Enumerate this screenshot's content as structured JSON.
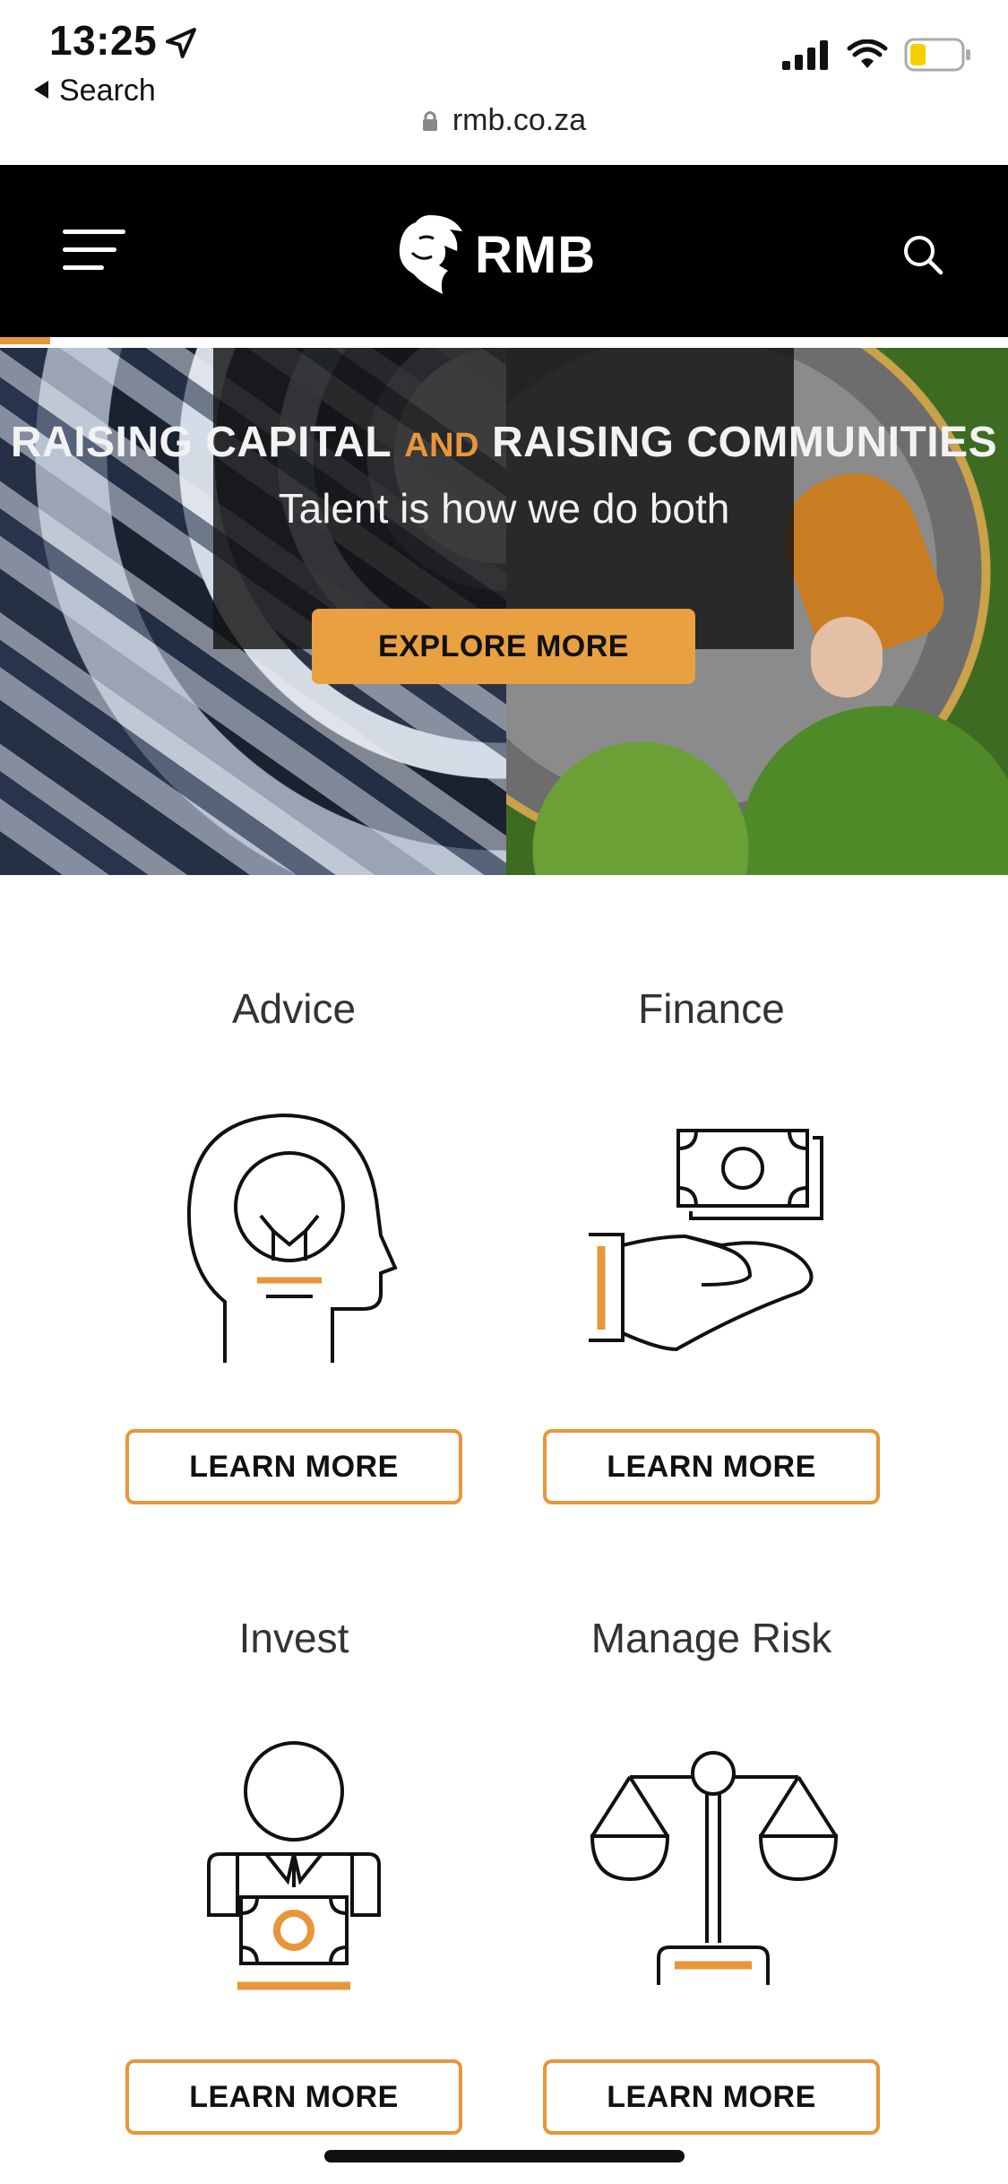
{
  "status_bar": {
    "time": "13:25",
    "back_label": "Search",
    "battery_color": "#f5d000"
  },
  "browser": {
    "url": "rmb.co.za"
  },
  "header": {
    "logo_text": "RMB",
    "menu_icon": "hamburger-icon",
    "search_icon": "search-icon"
  },
  "hero": {
    "headline_part1": "RAISING CAPITAL",
    "headline_and": "AND",
    "headline_part2": "RAISING COMMUNITIES",
    "subtitle": "Talent is how we do both",
    "cta_label": "EXPLORE MORE",
    "progress_fraction": 0.05
  },
  "services": [
    {
      "title": "Advice",
      "icon": "lightbulb-head-icon",
      "cta_label": "LEARN MORE"
    },
    {
      "title": "Finance",
      "icon": "money-hand-icon",
      "cta_label": "LEARN MORE"
    },
    {
      "title": "Invest",
      "icon": "investor-icon",
      "cta_label": "LEARN MORE"
    },
    {
      "title": "Manage Risk",
      "icon": "scales-icon",
      "cta_label": "LEARN MORE"
    }
  ],
  "colors": {
    "accent": "#e8963a",
    "header_bg": "#000000",
    "text": "#333333"
  }
}
